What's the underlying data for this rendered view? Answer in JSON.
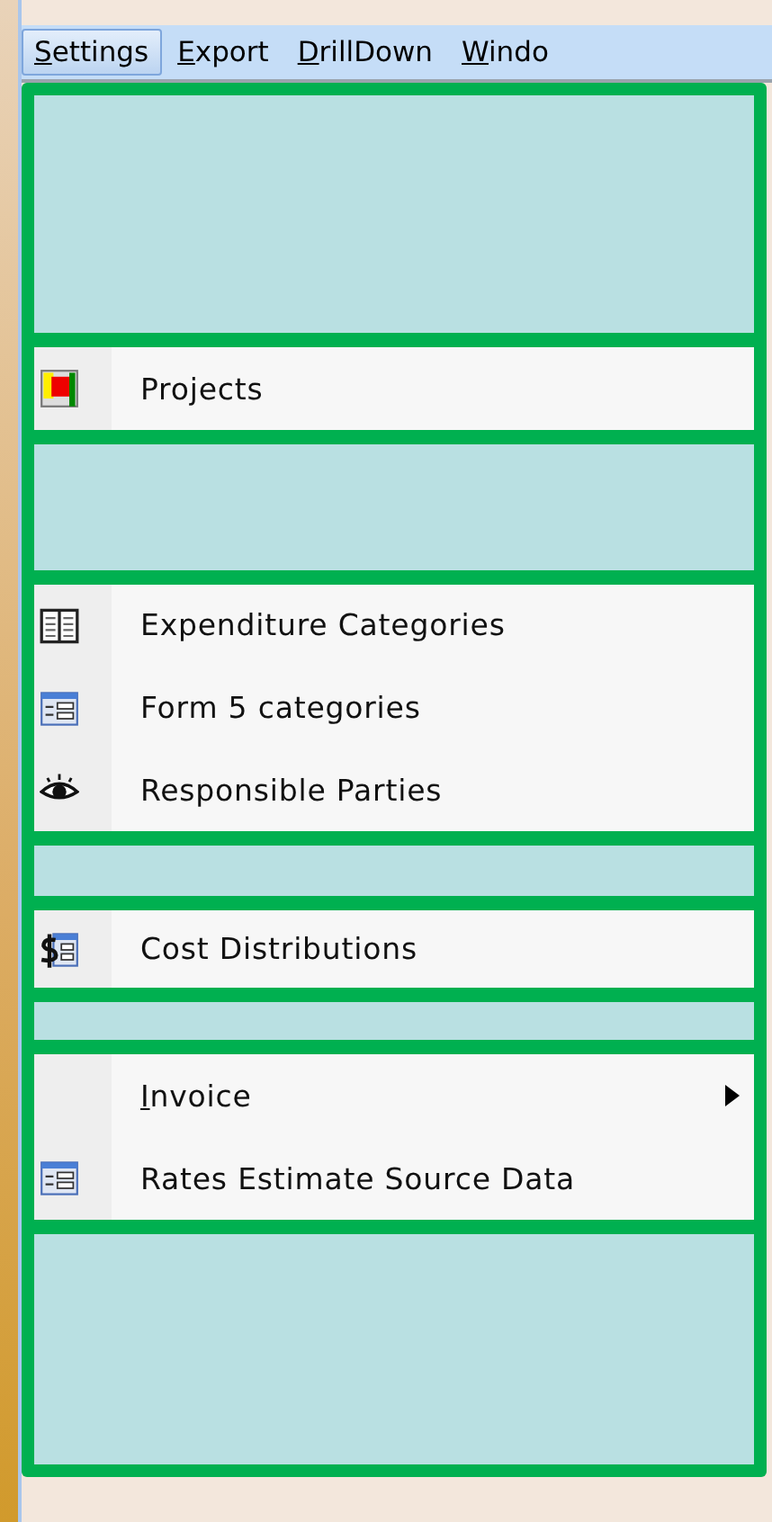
{
  "menubar": [
    {
      "label": "Settings",
      "selected": true,
      "mnemonic": true
    },
    {
      "label": "Export",
      "selected": false,
      "mnemonic": true
    },
    {
      "label": "DrillDown",
      "selected": false,
      "mnemonic": true
    },
    {
      "label": "Windo",
      "selected": false,
      "mnemonic": true
    }
  ],
  "menu": {
    "sections": [
      {
        "kind": "blank"
      },
      {
        "kind": "items",
        "items": [
          {
            "label": "Projects",
            "submenu": false,
            "mnemonic": false
          }
        ]
      },
      {
        "kind": "blank"
      },
      {
        "kind": "items",
        "items": [
          {
            "label": "Expenditure Categories",
            "submenu": false,
            "mnemonic": false
          },
          {
            "label": "Form 5 categories",
            "submenu": false,
            "mnemonic": false
          },
          {
            "label": "Responsible Parties",
            "submenu": false,
            "mnemonic": false
          }
        ]
      },
      {
        "kind": "blank"
      },
      {
        "kind": "items",
        "items": [
          {
            "label": "Cost Distributions",
            "submenu": false,
            "mnemonic": false
          }
        ]
      },
      {
        "kind": "blank"
      },
      {
        "kind": "items",
        "items": [
          {
            "label": "Invoice",
            "submenu": true,
            "mnemonic": true
          },
          {
            "label": "Rates Estimate Source Data",
            "submenu": false,
            "mnemonic": false
          }
        ]
      },
      {
        "kind": "blank"
      }
    ]
  }
}
